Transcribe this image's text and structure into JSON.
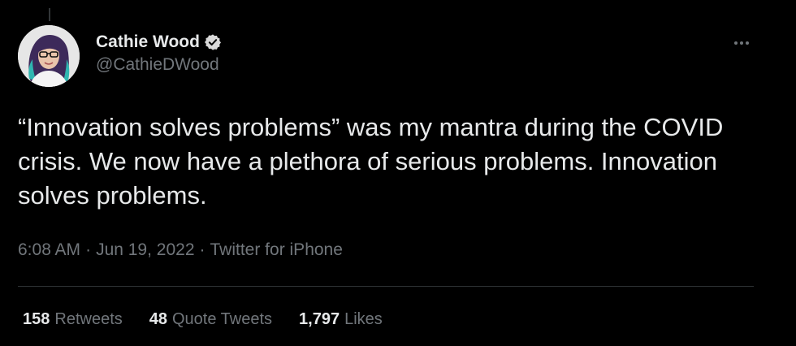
{
  "author": {
    "name": "Cathie Wood",
    "handle": "@CathieDWood",
    "verified": true,
    "avatar_icon": "profile-avatar"
  },
  "tweet": {
    "text": "“Innovation solves problems” was my mantra during the COVID crisis. We now have a plethora of serious problems. Innovation solves problems.",
    "time": "6:08 AM",
    "date": "Jun 19, 2022",
    "source": "Twitter for iPhone",
    "separator": "·"
  },
  "stats": {
    "retweets": {
      "count": "158",
      "label": "Retweets"
    },
    "quote_tweets": {
      "count": "48",
      "label": "Quote Tweets"
    },
    "likes": {
      "count": "1,797",
      "label": "Likes"
    }
  },
  "icons": {
    "verified": "verified-badge-icon",
    "more": "more-options-icon"
  },
  "colors": {
    "background": "#000000",
    "text_primary": "#e7e9ea",
    "text_secondary": "#71767b",
    "divider": "#2f3336",
    "verified_badge": "#d9d9d9"
  }
}
